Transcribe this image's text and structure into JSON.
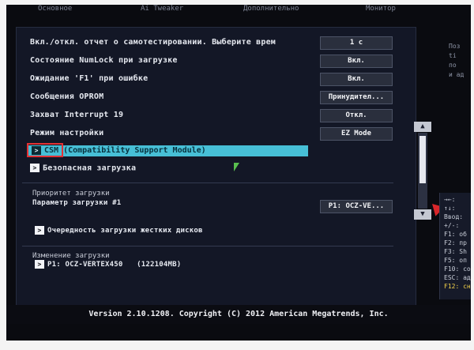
{
  "tabs": [
    "Основное",
    "Ai Tweaker",
    "Дополнительно",
    "Монитор"
  ],
  "settings": [
    {
      "label": "Вкл./откл. отчет о самотестировании. Выберите врем",
      "value": "1 с"
    },
    {
      "label": "Состояние NumLock при загрузке",
      "value": "Вкл."
    },
    {
      "label": "Ожидание 'F1' при ошибке",
      "value": "Вкл."
    },
    {
      "label": "Сообщения OPROM",
      "value": "Принудител..."
    },
    {
      "label": "Захват Interrupt 19",
      "value": "Откл."
    },
    {
      "label": "Режим настройки",
      "value": "EZ Mode"
    }
  ],
  "submenus": {
    "csm": {
      "label": "CSM (Compatibility Support Module)"
    },
    "secure_boot": {
      "label": "Безопасная загрузка"
    }
  },
  "boot_priority": {
    "title": "Приоритет загрузки",
    "option_label": "Параметр загрузки #1",
    "option_value": "P1: OCZ-VE..."
  },
  "hdd_order": {
    "label": "Очередность загрузки жестких дисков"
  },
  "boot_override": {
    "title": "Изменение загрузки",
    "item": "P1: OCZ-VERTEX450",
    "size": "(122104MB)"
  },
  "side_description": [
    "Поз",
    "ti",
    "по",
    "и ад"
  ],
  "help_keys": [
    "→←:",
    "↑↓:",
    "Ввод:",
    "+/-:",
    "F1:",
    "F2:",
    "F3:",
    "F5:",
    "F10:",
    "ESC:",
    "F12:"
  ],
  "help_values": [
    "",
    "",
    "",
    "",
    "об",
    "пр",
    "Sh",
    "оп",
    "со",
    "ад",
    "сн"
  ],
  "footer": "Version 2.10.1208. Copyright (C) 2012 American Megatrends, Inc.",
  "colors": {
    "highlight": "#47bfd6",
    "annotation_red": "#e23134",
    "f12_yellow": "#f3d34a"
  }
}
